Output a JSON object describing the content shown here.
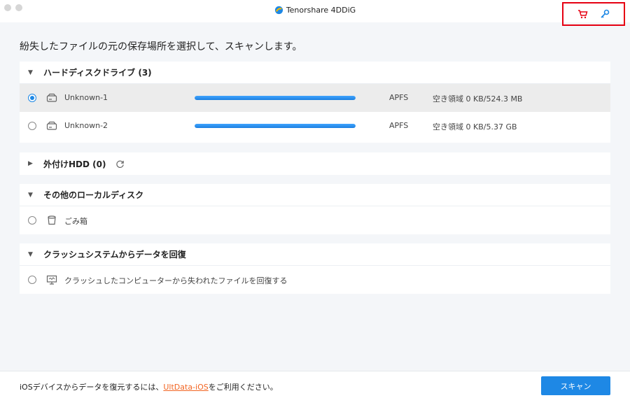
{
  "window": {
    "title": "Tenorshare 4DDiG"
  },
  "toolbar": {
    "cart_icon": "cart-icon",
    "key_icon": "key-icon",
    "accent": "#e60012"
  },
  "main": {
    "heading": "紛失したファイルの元の保存場所を選択して、スキャンします。"
  },
  "sections": {
    "hard_disks": {
      "title": "ハードディスクドライブ (3)",
      "items": [
        {
          "label": "Unknown-1",
          "fs": "APFS",
          "space": "空き領域 0 KB/524.3 MB",
          "usage": 1.0,
          "selected": true
        },
        {
          "label": "Unknown-2",
          "fs": "APFS",
          "space": "空き領域 0 KB/5.37 GB",
          "usage": 1.0,
          "selected": false
        }
      ]
    },
    "external": {
      "title": "外付けHDD (0)"
    },
    "other_local": {
      "title": "その他のローカルディスク",
      "items": [
        {
          "label": "ごみ箱"
        }
      ]
    },
    "crash": {
      "title": "クラッシュシステムからデータを回復",
      "items": [
        {
          "label": "クラッシュしたコンピューターから失われたファイルを回復する"
        }
      ]
    }
  },
  "footer": {
    "text_before": "iOSデバイスからデータを復元するには、",
    "link": "UltData-iOS",
    "text_after": "をご利用ください。",
    "scan_button": "スキャン"
  },
  "colors": {
    "primary": "#1e88e5",
    "link": "#f26522"
  }
}
